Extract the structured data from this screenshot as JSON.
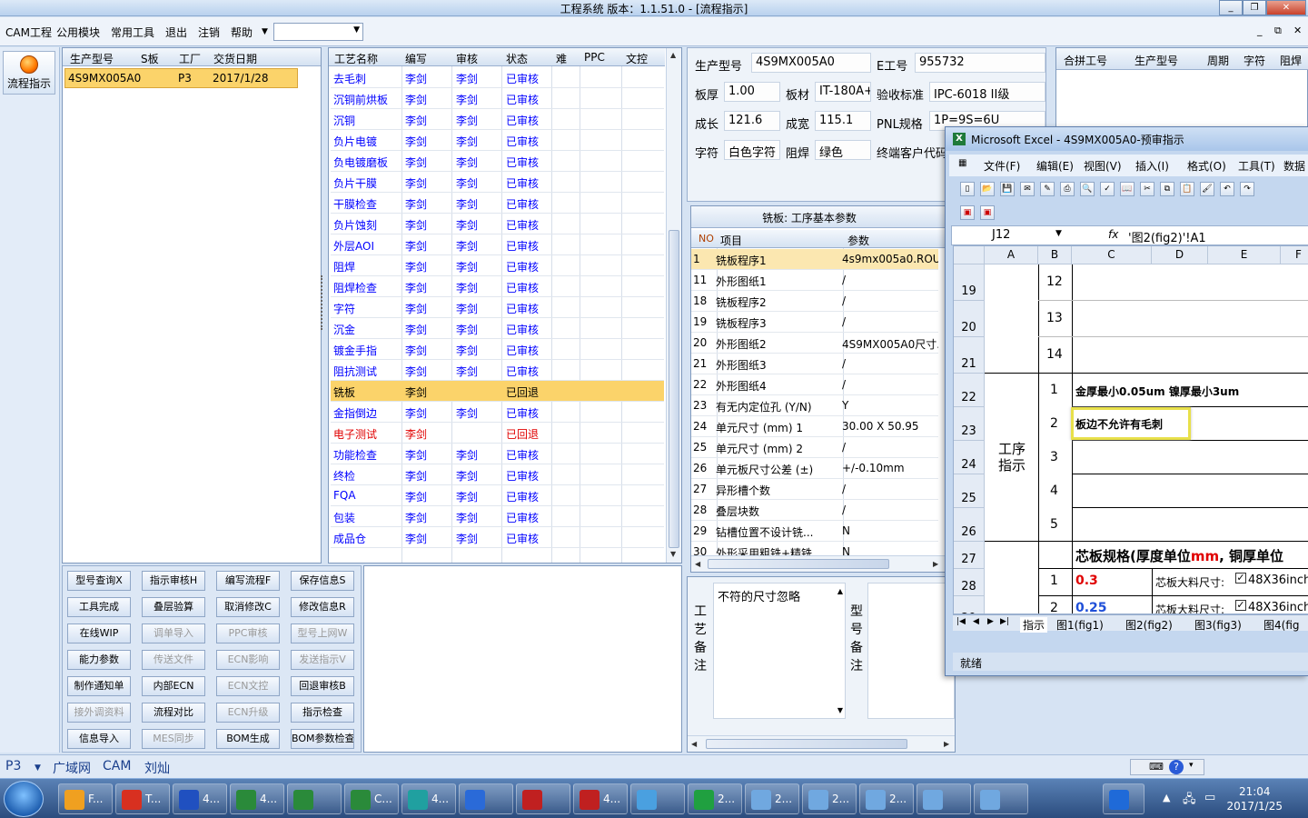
{
  "window": {
    "title": "工程系统   版本：1.1.51.0 - [流程指示]"
  },
  "menu": {
    "items": [
      "CAM工程",
      "公用模块",
      "常用工具",
      "退出",
      "注销",
      "帮助"
    ],
    "combo_value": "",
    "mdi_controls": [
      "_",
      "⧉",
      "✕"
    ]
  },
  "nav": {
    "label": "流程指示"
  },
  "orders": {
    "headers": [
      "生产型号",
      "S板",
      "工厂",
      "交货日期"
    ],
    "rows": [
      {
        "model": "4S9MX005A0",
        "s": "",
        "factory": "P3",
        "date": "2017/1/28"
      }
    ]
  },
  "process": {
    "headers": [
      "工艺名称",
      "编写",
      "审核",
      "状态",
      "难",
      "PPC",
      "文控"
    ],
    "rows": [
      {
        "name": "去毛刺",
        "writer": "李剑",
        "reviewer": "李剑",
        "status": "已审核"
      },
      {
        "name": "沉铜前烘板",
        "writer": "李剑",
        "reviewer": "李剑",
        "status": "已审核"
      },
      {
        "name": "沉铜",
        "writer": "李剑",
        "reviewer": "李剑",
        "status": "已审核"
      },
      {
        "name": "负片电镀",
        "writer": "李剑",
        "reviewer": "李剑",
        "status": "已审核"
      },
      {
        "name": "负电镀磨板",
        "writer": "李剑",
        "reviewer": "李剑",
        "status": "已审核"
      },
      {
        "name": "负片干膜",
        "writer": "李剑",
        "reviewer": "李剑",
        "status": "已审核"
      },
      {
        "name": "干膜检查",
        "writer": "李剑",
        "reviewer": "李剑",
        "status": "已审核"
      },
      {
        "name": "负片蚀刻",
        "writer": "李剑",
        "reviewer": "李剑",
        "status": "已审核"
      },
      {
        "name": "外层AOI",
        "writer": "李剑",
        "reviewer": "李剑",
        "status": "已审核"
      },
      {
        "name": "阻焊",
        "writer": "李剑",
        "reviewer": "李剑",
        "status": "已审核"
      },
      {
        "name": "阻焊检查",
        "writer": "李剑",
        "reviewer": "李剑",
        "status": "已审核"
      },
      {
        "name": "字符",
        "writer": "李剑",
        "reviewer": "李剑",
        "status": "已审核"
      },
      {
        "name": "沉金",
        "writer": "李剑",
        "reviewer": "李剑",
        "status": "已审核"
      },
      {
        "name": "镀金手指",
        "writer": "李剑",
        "reviewer": "李剑",
        "status": "已审核"
      },
      {
        "name": "阻抗测试",
        "writer": "李剑",
        "reviewer": "李剑",
        "status": "已审核"
      },
      {
        "name": "铣板",
        "writer": "李剑",
        "reviewer": "",
        "status": "已回退"
      },
      {
        "name": "金指倒边",
        "writer": "李剑",
        "reviewer": "李剑",
        "status": "已审核"
      },
      {
        "name": "电子测试",
        "writer": "李剑",
        "reviewer": "",
        "status": "已回退"
      },
      {
        "name": "功能检查",
        "writer": "李剑",
        "reviewer": "李剑",
        "status": "已审核"
      },
      {
        "name": "终检",
        "writer": "李剑",
        "reviewer": "李剑",
        "status": "已审核"
      },
      {
        "name": "FQA",
        "writer": "李剑",
        "reviewer": "李剑",
        "status": "已审核"
      },
      {
        "name": "包装",
        "writer": "李剑",
        "reviewer": "李剑",
        "status": "已审核"
      },
      {
        "name": "成品仓",
        "writer": "李剑",
        "reviewer": "李剑",
        "status": "已审核"
      }
    ]
  },
  "actions": [
    [
      "型号查询X",
      "指示审核H",
      "编写流程F",
      "保存信息S"
    ],
    [
      "工具完成",
      "叠层验算",
      "取消修改C",
      "修改信息R"
    ],
    [
      "在线WIP",
      "调单导入",
      "PPC审核",
      "型号上网W"
    ],
    [
      "能力参数",
      "传送文件",
      "ECN影响",
      "发送指示V"
    ],
    [
      "制作通知单",
      "内部ECN",
      "ECN文控",
      "回退审核B"
    ],
    [
      "接外调资料",
      "流程对比",
      "ECN升级",
      "指示检查"
    ],
    [
      "信息导入",
      "MES同步",
      "BOM生成",
      "BOM参数检查"
    ]
  ],
  "actions_disabled": [
    "调单导入",
    "PPC审核",
    "型号上网W",
    "传送文件",
    "ECN影响",
    "发送指示V",
    "ECN文控",
    "接外调资料",
    "ECN升级",
    "MES同步"
  ],
  "info": {
    "model_label": "生产型号",
    "model": "4S9MX005A0",
    "e_label": "E工号",
    "e": "955732",
    "thick_label": "板厚",
    "thick": "1.00",
    "mat_label": "板材",
    "mat": "IT-180A+",
    "accept_label": "验收标准",
    "accept": "IPC-6018 II级",
    "len_label": "成长",
    "len": "121.6",
    "wid_label": "成宽",
    "wid": "115.1",
    "pnl_label": "PNL规格",
    "pnl": "1P=9S=6U",
    "char_label": "字符",
    "char": "白色字符",
    "mask_label": "阻焊",
    "mask": "绿色",
    "cust_label": "终端客户代码"
  },
  "merge": {
    "headers": [
      "合拼工号",
      "生产型号",
      "周期",
      "字符",
      "阻焊"
    ]
  },
  "params": {
    "title": "铣板: 工序基本参数",
    "headers": [
      "NO",
      "项目",
      "参数"
    ],
    "rows": [
      {
        "no": "1",
        "item": "铣板程序1",
        "val": "4s9mx005a0.ROU"
      },
      {
        "no": "11",
        "item": "外形图纸1",
        "val": "/"
      },
      {
        "no": "18",
        "item": "铣板程序2",
        "val": "/"
      },
      {
        "no": "19",
        "item": "铣板程序3",
        "val": "/"
      },
      {
        "no": "20",
        "item": "外形图纸2",
        "val": "4S9MX005A0尺寸..."
      },
      {
        "no": "21",
        "item": "外形图纸3",
        "val": "/"
      },
      {
        "no": "22",
        "item": "外形图纸4",
        "val": "/"
      },
      {
        "no": "23",
        "item": "有无内定位孔 (Y/N)",
        "val": "Y"
      },
      {
        "no": "24",
        "item": "单元尺寸 (mm) 1",
        "val": "30.00 X 50.95"
      },
      {
        "no": "25",
        "item": "单元尺寸 (mm) 2",
        "val": "/"
      },
      {
        "no": "26",
        "item": "单元板尺寸公差 (±)",
        "val": "+/-0.10mm"
      },
      {
        "no": "27",
        "item": "异形槽个数",
        "val": "/"
      },
      {
        "no": "28",
        "item": "叠层块数",
        "val": "/"
      },
      {
        "no": "29",
        "item": "钻槽位置不设计铣...",
        "val": "N"
      },
      {
        "no": "30",
        "item": "外形采用粗铣+精铣...",
        "val": "N"
      }
    ]
  },
  "remarks": {
    "process_label": "工艺备注",
    "process_text": "不符的尺寸忽略",
    "model_label": "型号备注"
  },
  "excel": {
    "title": "Microsoft Excel - 4S9MX005A0-预审指示",
    "menu": [
      "文件(F)",
      "编辑(E)",
      "视图(V)",
      "插入(I)",
      "格式(O)",
      "工具(T)",
      "数据"
    ],
    "namebox": "J12",
    "fx": "fx",
    "formula": "'图2(fig2)'!A1",
    "cols": [
      "A",
      "B",
      "C",
      "D",
      "E",
      "F"
    ],
    "rows": [
      "19",
      "20",
      "21",
      "22",
      "23",
      "24",
      "25",
      "26",
      "27",
      "28",
      "29"
    ],
    "cells": {
      "b19": "12",
      "b20": "13",
      "b21": "14",
      "b22": "1",
      "c22": "金厚最小0.05um 镍厚最小3um",
      "b23": "2",
      "c23": "板边不允许有毛刺",
      "b24": "3",
      "b25": "4",
      "b26": "5",
      "a_merge": "工序指示",
      "c27a": "芯板规格(厚度单位",
      "c27b": "mm",
      "c27c": ", 铜厚单位",
      "b28": "1",
      "c28": "0.3",
      "d28": "芯板大料尺寸:",
      "e28": "48X36inch",
      "b29": "2",
      "c29": "0.25",
      "d29": "芯板大料尺寸:",
      "e29": "48X36inch"
    },
    "tabs": [
      "指示",
      "图1(fig1)",
      "图2(fig2)",
      "图3(fig3)",
      "图4(fig"
    ],
    "status": "就绪"
  },
  "bottom": {
    "factory": "P3",
    "links": [
      "广域网",
      "CAM",
      "刘灿"
    ]
  },
  "taskbar": {
    "tasks": [
      "F...",
      "T...",
      "4...",
      "4...",
      "",
      "C...",
      "4...",
      "",
      "",
      "4...",
      "",
      "2...",
      "2...",
      "2...",
      "2...",
      "",
      ""
    ],
    "time": "21:04",
    "date": "2017/1/25"
  },
  "colors": {
    "accent": "#0000ff",
    "selected": "#fbd36a",
    "warning": "#e00000"
  }
}
